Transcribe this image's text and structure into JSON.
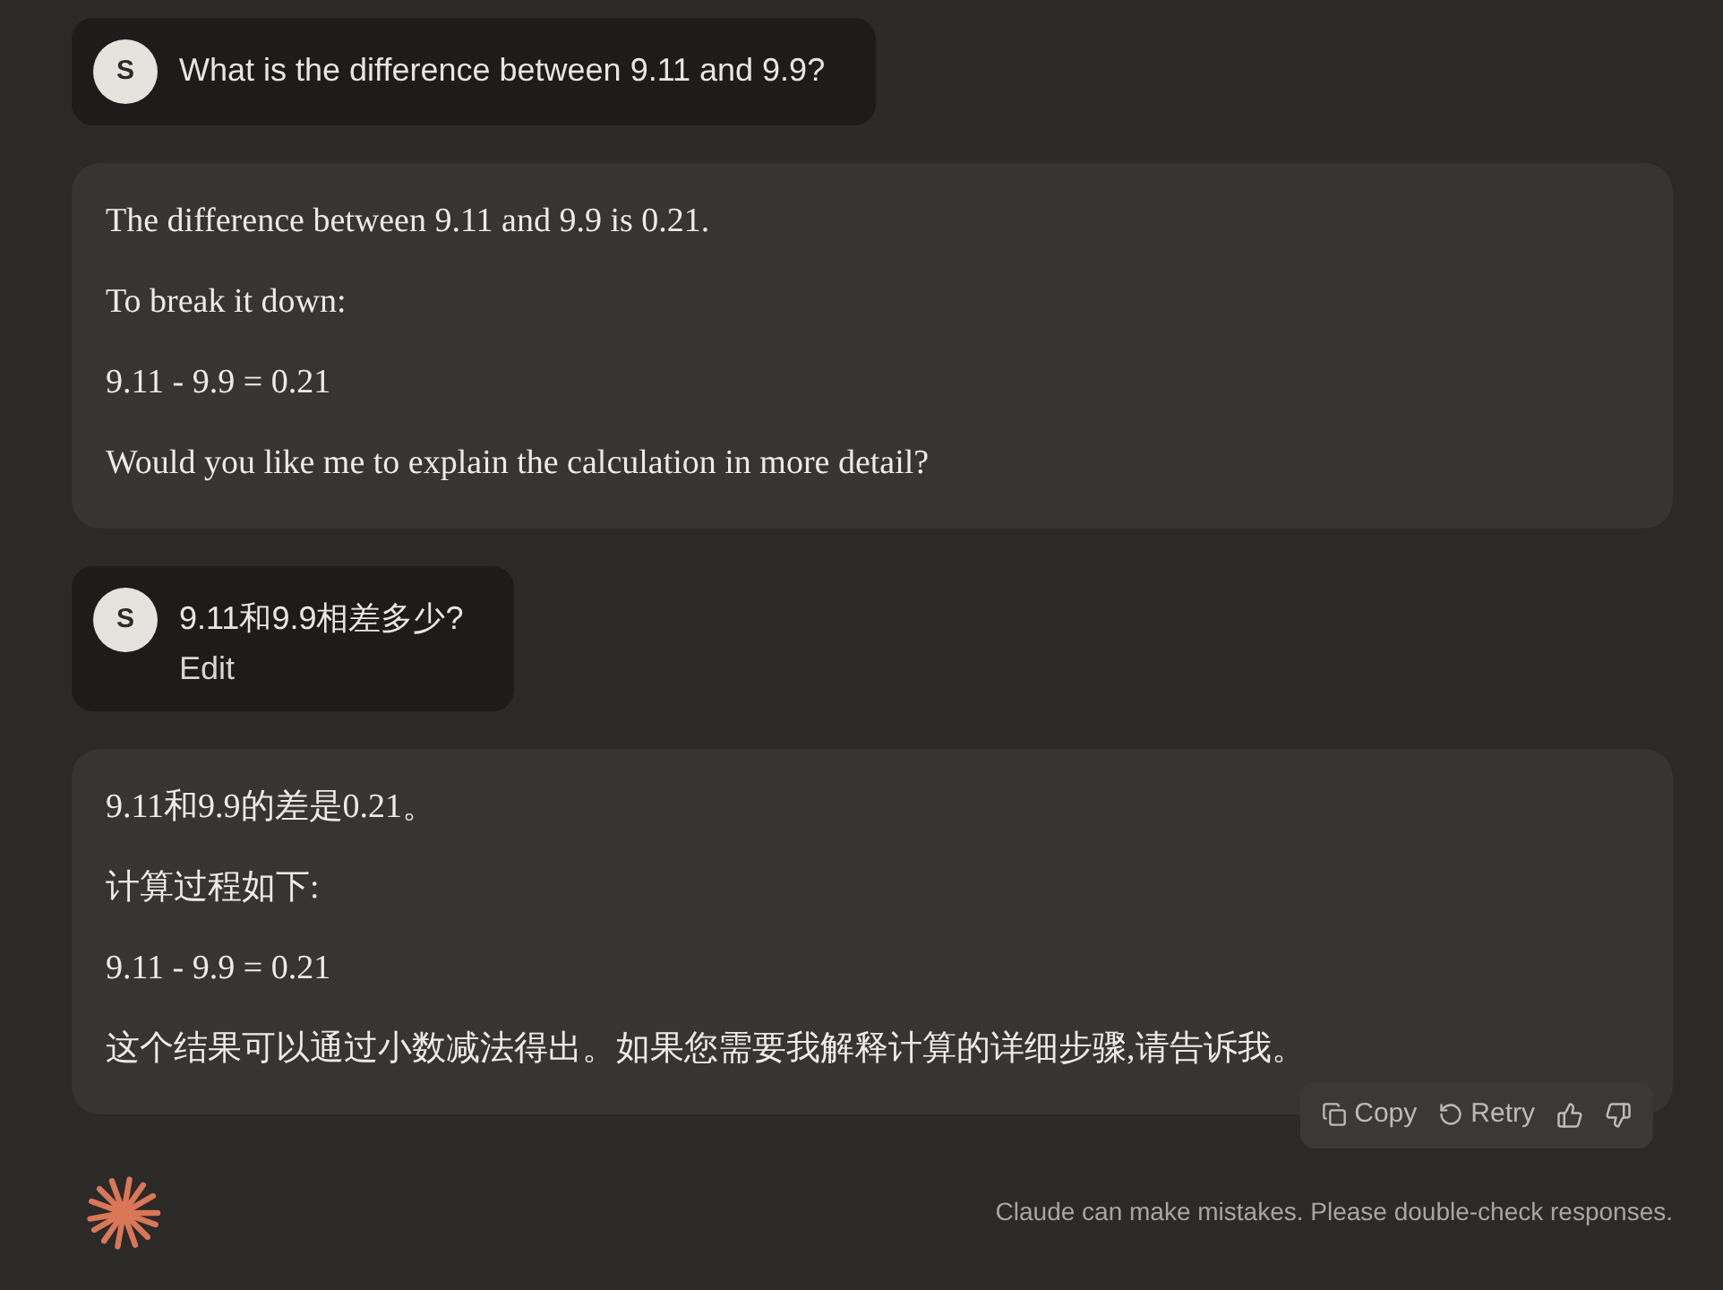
{
  "messages": [
    {
      "kind": "user",
      "avatar": "S",
      "text": "What is the difference between 9.11 and 9.9?"
    },
    {
      "kind": "assistant",
      "paragraphs": [
        "The difference between 9.11 and 9.9 is 0.21.",
        "To break it down:",
        "9.11 - 9.9 = 0.21",
        "Would you like me to explain the calculation in more detail?"
      ]
    },
    {
      "kind": "user",
      "avatar": "S",
      "text": "9.11和9.9相差多少?",
      "edit": "Edit"
    },
    {
      "kind": "assistant",
      "paragraphs": [
        "9.11和9.9的差是0.21。",
        "计算过程如下:",
        "9.11 - 9.9 = 0.21",
        "这个结果可以通过小数减法得出。如果您需要我解释计算的详细步骤,请告诉我。"
      ],
      "actions": {
        "copy": "Copy",
        "retry": "Retry"
      }
    }
  ],
  "disclaimer": "Claude can make mistakes. Please double-check responses."
}
